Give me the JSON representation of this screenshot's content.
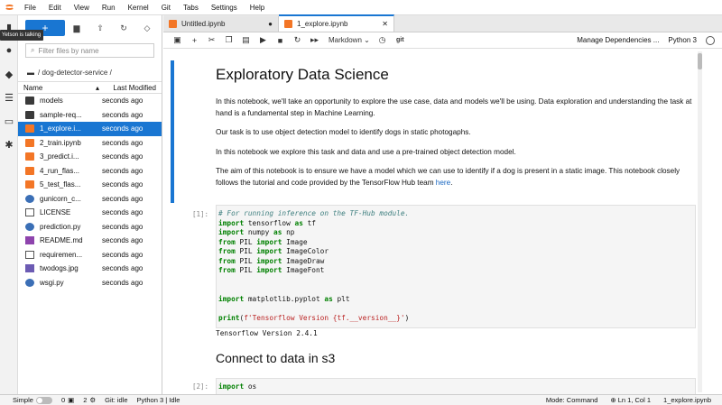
{
  "menu": [
    "File",
    "Edit",
    "View",
    "Run",
    "Kernel",
    "Git",
    "Tabs",
    "Settings",
    "Help"
  ],
  "tooltip": "Yetson is talking",
  "filebrowser": {
    "new_label": "+",
    "filter_placeholder": "Filter files by name",
    "breadcrumb": "/ dog-detector-service /",
    "col_name": "Name",
    "col_modified": "Last Modified",
    "rows": [
      {
        "name": "models",
        "modified": "seconds ago",
        "icon": "folder"
      },
      {
        "name": "sample-req...",
        "modified": "seconds ago",
        "icon": "folder"
      },
      {
        "name": "1_explore.i...",
        "modified": "seconds ago",
        "icon": "notebook",
        "selected": true
      },
      {
        "name": "2_train.ipynb",
        "modified": "seconds ago",
        "icon": "notebook"
      },
      {
        "name": "3_predict.i...",
        "modified": "seconds ago",
        "icon": "notebook"
      },
      {
        "name": "4_run_flas...",
        "modified": "seconds ago",
        "icon": "notebook"
      },
      {
        "name": "5_test_flas...",
        "modified": "seconds ago",
        "icon": "notebook"
      },
      {
        "name": "gunicorn_c...",
        "modified": "seconds ago",
        "icon": "python"
      },
      {
        "name": "LICENSE",
        "modified": "seconds ago",
        "icon": "file"
      },
      {
        "name": "prediction.py",
        "modified": "seconds ago",
        "icon": "python"
      },
      {
        "name": "README.md",
        "modified": "seconds ago",
        "icon": "markdown"
      },
      {
        "name": "requiremen...",
        "modified": "seconds ago",
        "icon": "file"
      },
      {
        "name": "twodogs.jpg",
        "modified": "seconds ago",
        "icon": "image"
      },
      {
        "name": "wsgi.py",
        "modified": "seconds ago",
        "icon": "python"
      }
    ]
  },
  "tabs": [
    {
      "label": "Untitled.ipynb",
      "active": false
    },
    {
      "label": "1_explore.ipynb",
      "active": true
    }
  ],
  "toolbar": {
    "cell_type": "Markdown",
    "git": "git",
    "manage_deps": "Manage Dependencies ...",
    "kernel": "Python 3"
  },
  "notebook": {
    "title": "Exploratory Data Science",
    "paragraphs": [
      "In this notebook, we'll take an opportunity to explore the use case, data and models we'll be using. Data exploration and understanding the task at hand is a fundamental step in Machine Learning.",
      "Our task is to use object detection model to identify dogs in static photogaphs.",
      "In this notebook we explore this task and data and use a pre-trained object detection model.",
      "The aim of this notebook is to ensure we have a model which we can use to identify if a dog is present in a static image. This notebook closely follows the tutorial and code provided by the TensorFlow Hub team"
    ],
    "link_text": "here",
    "cell1_prompt": "[1]:",
    "code1": [
      {
        "t": "cm",
        "v": "# For running inference on the TF-Hub module."
      },
      {
        "t": "imp",
        "a": "import",
        "b": " tensorflow ",
        "c": "as",
        "d": " tf"
      },
      {
        "t": "imp",
        "a": "import",
        "b": " numpy ",
        "c": "as",
        "d": " np"
      },
      {
        "t": "from",
        "a": "from",
        "b": " PIL ",
        "c": "import",
        "d": " Image"
      },
      {
        "t": "from",
        "a": "from",
        "b": " PIL ",
        "c": "import",
        "d": " ImageColor"
      },
      {
        "t": "from",
        "a": "from",
        "b": " PIL ",
        "c": "import",
        "d": " ImageDraw"
      },
      {
        "t": "from",
        "a": "from",
        "b": " PIL ",
        "c": "import",
        "d": " ImageFont"
      },
      {
        "t": "blank"
      },
      {
        "t": "blank"
      },
      {
        "t": "imp",
        "a": "import",
        "b": " matplotlib.pyplot ",
        "c": "as",
        "d": " plt"
      },
      {
        "t": "blank"
      },
      {
        "t": "print",
        "a": "print",
        "b": "(",
        "c": "f'Tensorflow Version {tf.__version__}'",
        "d": ")"
      }
    ],
    "output1": "Tensorflow Version 2.4.1",
    "h2": "Connect to data in s3",
    "cell2_prompt": "[2]:",
    "code2_kw": "import",
    "code2_rest": " os"
  },
  "status": {
    "mode_label": "Simple",
    "count1": "0",
    "count2": "2",
    "git": "Git: idle",
    "kernel": "Python 3 | Idle",
    "mode": "Mode: Command",
    "position": "Ln 1, Col 1",
    "file": "1_explore.ipynb"
  }
}
